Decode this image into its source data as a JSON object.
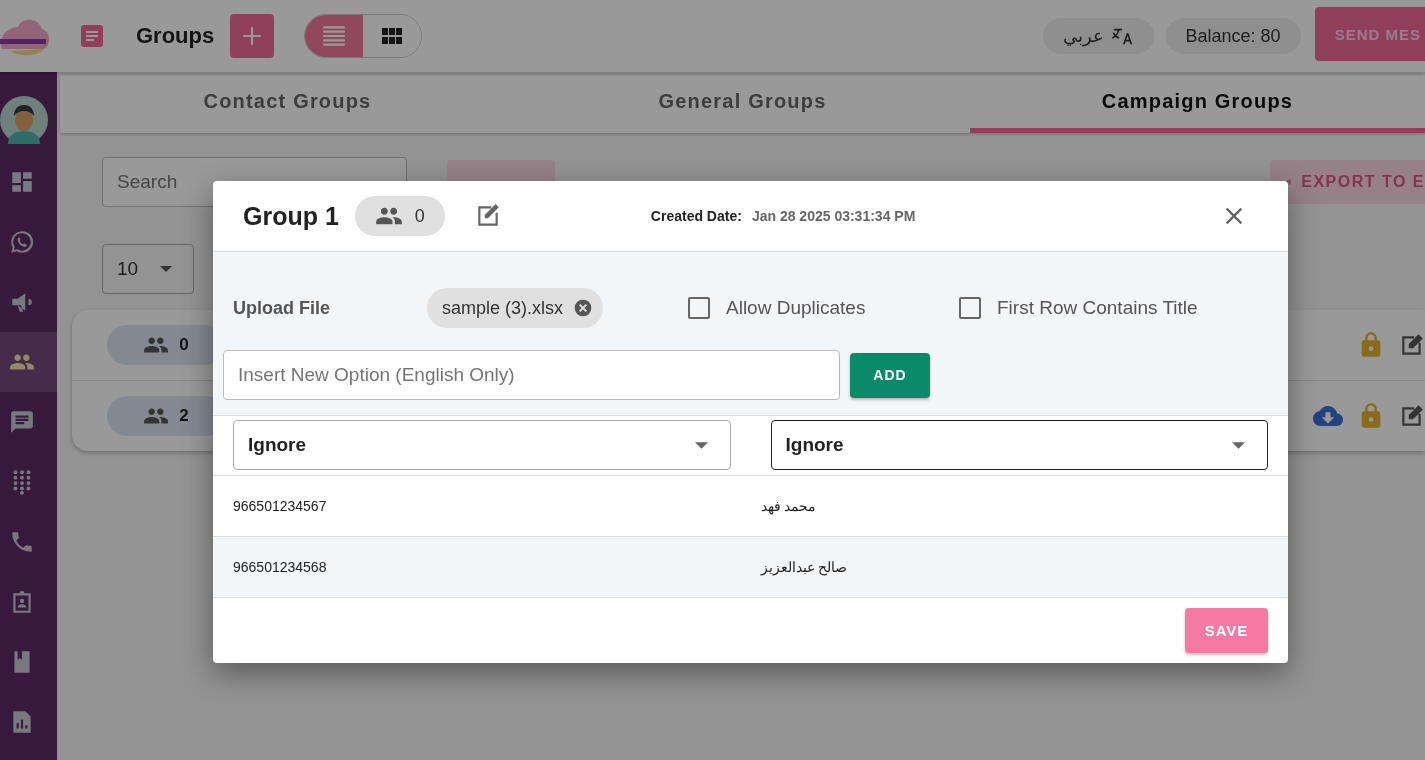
{
  "header": {
    "title": "Groups",
    "language": "عربي",
    "balance": "Balance: 80",
    "send_button": "SEND MES",
    "view_modes": [
      {
        "kind": "list",
        "selected": true
      },
      {
        "kind": "grid",
        "selected": false
      }
    ]
  },
  "sidebar": {
    "items": [
      {
        "kind": "dashboard",
        "selected": false
      },
      {
        "kind": "whatsapp",
        "selected": false
      },
      {
        "kind": "megaphone",
        "selected": false
      },
      {
        "kind": "people",
        "selected": true
      },
      {
        "kind": "chat",
        "selected": false
      },
      {
        "kind": "dialpad",
        "selected": false
      },
      {
        "kind": "phone",
        "selected": false
      },
      {
        "kind": "badge",
        "selected": false
      },
      {
        "kind": "book",
        "selected": false
      },
      {
        "kind": "report",
        "selected": false
      }
    ]
  },
  "tabs": [
    {
      "label": "Contact Groups",
      "selected": false
    },
    {
      "label": "General Groups",
      "selected": false
    },
    {
      "label": "Campaign Groups",
      "selected": true
    }
  ],
  "toolbar": {
    "search": {
      "placeholder": "Search"
    },
    "page_size": "10",
    "export_button": "EXPORT TO E"
  },
  "groups": [
    {
      "count": "0",
      "downloadable": false
    },
    {
      "count": "2",
      "downloadable": true
    }
  ],
  "dialog": {
    "title": "Group 1",
    "member_count": "0",
    "created_label": "Created Date:",
    "created_value": "Jan 28 2025 03:31:34 PM",
    "upload_label": "Upload File",
    "file_chip": "sample (3).xlsx",
    "options": [
      {
        "label": "Allow Duplicates",
        "checked": false
      },
      {
        "label": "First Row Contains Title",
        "checked": false
      }
    ],
    "new_option": {
      "placeholder": "Insert New Option (English Only)"
    },
    "add_button": "ADD",
    "columns": [
      {
        "value": "Ignore",
        "focused": false
      },
      {
        "value": "Ignore",
        "focused": true
      }
    ],
    "rows": [
      [
        "966501234567",
        "محمد فهد"
      ],
      [
        "966501234568",
        "صالح عبدالعزيز"
      ]
    ],
    "save_button": "SAVE"
  }
}
